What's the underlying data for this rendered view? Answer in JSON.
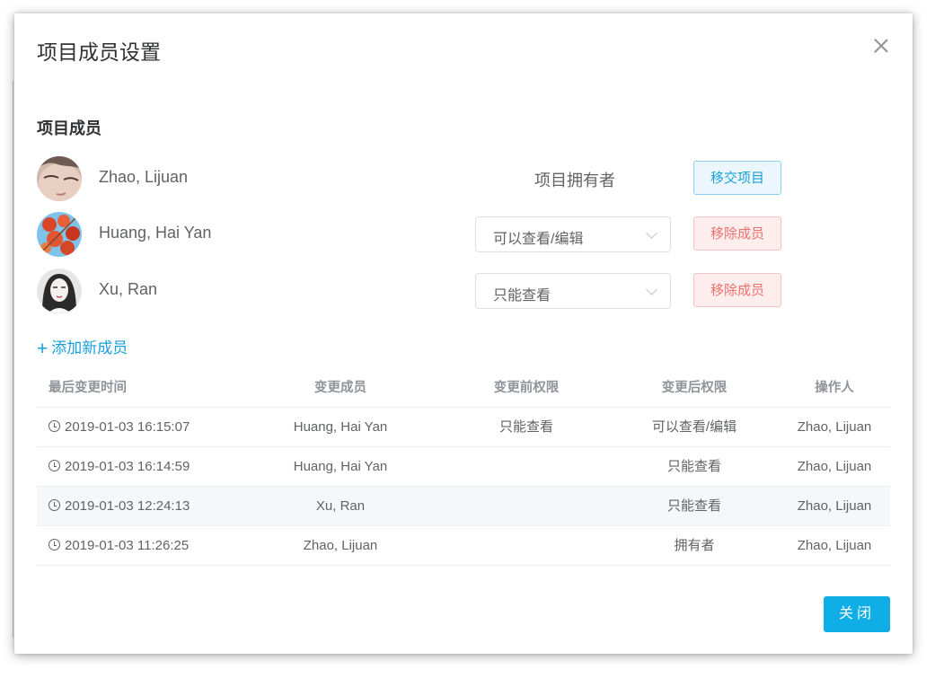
{
  "dialog": {
    "title": "项目成员设置",
    "close_icon": "close-icon"
  },
  "members_section": {
    "title": "项目成员",
    "members": [
      {
        "name": "Zhao, Lijuan",
        "role_label": "项目拥有者",
        "action_label": "移交项目"
      },
      {
        "name": "Huang, Hai Yan",
        "permission": "可以查看/编辑",
        "action_label": "移除成员"
      },
      {
        "name": "Xu, Ran",
        "permission": "只能查看",
        "action_label": "移除成员"
      }
    ],
    "add_member_label": "添加新成员",
    "add_icon": "plus-icon"
  },
  "history_table": {
    "columns": [
      "最后变更时间",
      "变更成员",
      "变更前权限",
      "变更后权限",
      "操作人"
    ],
    "rows": [
      {
        "time": "2019-01-03 16:15:07",
        "member": "Huang, Hai Yan",
        "before": "只能查看",
        "after": "可以查看/编辑",
        "operator": "Zhao, Lijuan"
      },
      {
        "time": "2019-01-03 16:14:59",
        "member": "Huang, Hai Yan",
        "before": "",
        "after": "只能查看",
        "operator": "Zhao, Lijuan"
      },
      {
        "time": "2019-01-03 12:24:13",
        "member": "Xu, Ran",
        "before": "",
        "after": "只能查看",
        "operator": "Zhao, Lijuan"
      },
      {
        "time": "2019-01-03 11:26:25",
        "member": "Zhao, Lijuan",
        "before": "",
        "after": "拥有者",
        "operator": "Zhao, Lijuan"
      }
    ]
  },
  "footer": {
    "close_label": "关闭"
  },
  "colors": {
    "primary": "#0faee6",
    "link": "#1c9fd8",
    "danger": "#f0706c"
  }
}
